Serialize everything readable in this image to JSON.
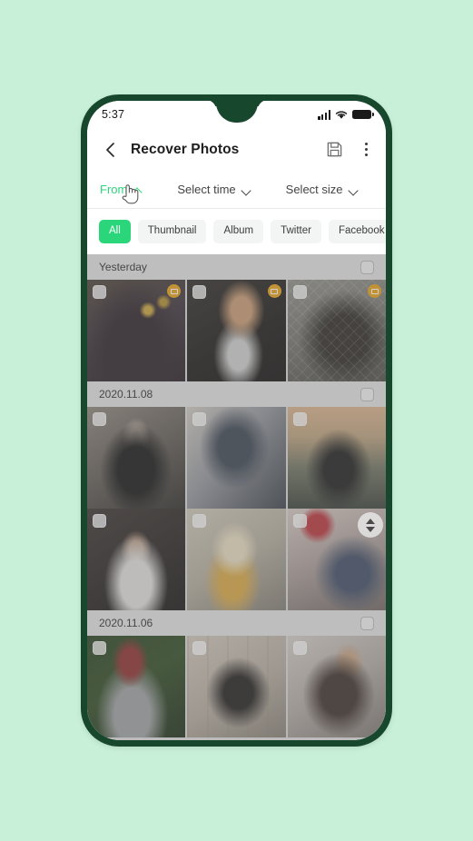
{
  "theme": {
    "page_background": "#c8f0d8",
    "phone_frame": "#17472c",
    "accent_green": "#2bd67b",
    "badge_orange": "#e8a215"
  },
  "status_bar": {
    "time": "5:37",
    "signal_icon": "signal-bars-icon",
    "wifi_icon": "wifi-icon",
    "battery_icon": "battery-icon"
  },
  "app_bar": {
    "back_icon": "chevron-left-icon",
    "title": "Recover Photos",
    "save_icon": "floppy-disk-save-icon",
    "menu_icon": "kebab-menu-icon"
  },
  "filters": [
    {
      "label": "From",
      "active": true,
      "chevron": "chevron-up-icon"
    },
    {
      "label": "Select time",
      "active": false,
      "chevron": "chevron-down-icon"
    },
    {
      "label": "Select size",
      "active": false,
      "chevron": "chevron-down-icon"
    }
  ],
  "cursor": {
    "icon": "hand-pointer-cursor"
  },
  "chips": [
    {
      "label": "All",
      "selected": true
    },
    {
      "label": "Thumbnail",
      "selected": false
    },
    {
      "label": "Album",
      "selected": false
    },
    {
      "label": "Twitter",
      "selected": false
    },
    {
      "label": "Facebook",
      "selected": false
    }
  ],
  "sections": [
    {
      "date": "Yesterday",
      "select_all_icon": "checkbox-unchecked-icon",
      "rows": [
        [
          {
            "name": "photo-woman-dark-hair-flowers",
            "checkbox": "checkbox-unchecked-icon",
            "badge": "cloud-source-badge-icon",
            "has_badge": true
          },
          {
            "name": "photo-man-suit-tie",
            "checkbox": "checkbox-unchecked-icon",
            "badge": "cloud-source-badge-icon",
            "has_badge": true
          },
          {
            "name": "photo-woman-hat-fence",
            "checkbox": "checkbox-unchecked-icon",
            "badge": "cloud-source-badge-icon",
            "has_badge": true
          }
        ]
      ]
    },
    {
      "date": "2020.11.08",
      "select_all_icon": "checkbox-unchecked-icon",
      "rows": [
        [
          {
            "name": "photo-man-black-tshirt-steps",
            "checkbox": "checkbox-unchecked-icon",
            "has_badge": false
          },
          {
            "name": "photo-man-beanie-winter",
            "checkbox": "checkbox-unchecked-icon",
            "has_badge": false
          },
          {
            "name": "photo-woman-black-top-sunset",
            "checkbox": "checkbox-unchecked-icon",
            "has_badge": false
          }
        ],
        [
          {
            "name": "photo-man-glasses-beard-indoor",
            "checkbox": "checkbox-unchecked-icon",
            "has_badge": false
          },
          {
            "name": "photo-blonde-woman-yellow-shirt",
            "checkbox": "checkbox-unchecked-icon",
            "has_badge": false
          },
          {
            "name": "photo-woman-sunglasses-street",
            "checkbox": "checkbox-unchecked-icon",
            "has_badge": false
          }
        ]
      ]
    },
    {
      "date": "2020.11.06",
      "select_all_icon": "checkbox-unchecked-icon",
      "rows": [
        [
          {
            "name": "photo-bearded-man-red-cap",
            "checkbox": "checkbox-unchecked-icon",
            "has_badge": false
          },
          {
            "name": "photo-woman-black-dress-rails",
            "checkbox": "checkbox-unchecked-icon",
            "has_badge": false
          },
          {
            "name": "photo-woman-looking-up-wall",
            "checkbox": "checkbox-unchecked-icon",
            "has_badge": false
          }
        ]
      ]
    }
  ],
  "scroll_knob": {
    "up_icon": "triangle-up-icon",
    "down_icon": "triangle-down-icon"
  }
}
